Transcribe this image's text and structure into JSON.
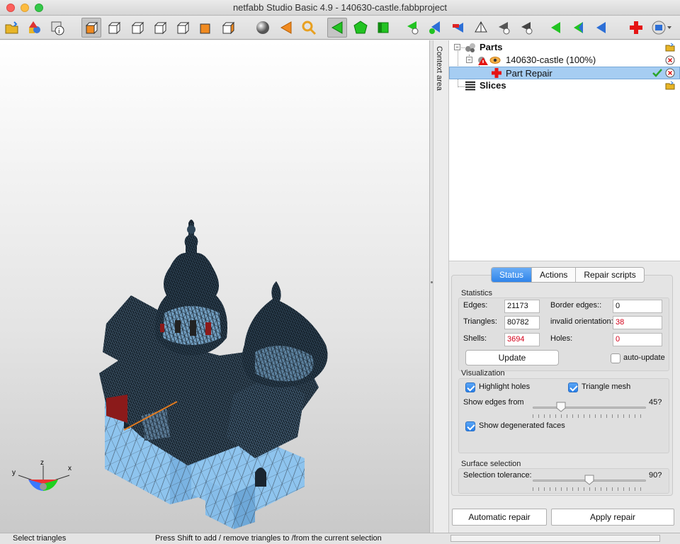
{
  "window": {
    "title": "netfabb Studio Basic 4.9 - 140630-castle.fabbproject"
  },
  "sidebar": {
    "context_label": "Context area"
  },
  "tree": {
    "parts_label": "Parts",
    "part_label": "140630-castle (100%)",
    "repair_label": "Part Repair",
    "slices_label": "Slices"
  },
  "panel": {
    "tabs": [
      {
        "label": "Status",
        "active": true
      },
      {
        "label": "Actions",
        "active": false
      },
      {
        "label": "Repair scripts",
        "active": false
      }
    ],
    "statistics": {
      "title": "Statistics",
      "edges_label": "Edges:",
      "edges_value": "21173",
      "border_edges_label": "Border edges::",
      "border_edges_value": "0",
      "triangles_label": "Triangles:",
      "triangles_value": "80782",
      "invalid_orientation_label": "invalid orientation:",
      "invalid_orientation_value": "38",
      "shells_label": "Shells:",
      "shells_value": "3694",
      "holes_label": "Holes:",
      "holes_value": "0",
      "update_label": "Update",
      "auto_update_label": "auto-update",
      "auto_update_checked": false
    },
    "visualization": {
      "title": "Visualization",
      "highlight_holes_label": "Highlight holes",
      "highlight_holes_checked": true,
      "triangle_mesh_label": "Triangle mesh",
      "triangle_mesh_checked": true,
      "show_edges_label": "Show edges from",
      "show_edges_value": "45?",
      "show_edges_slider_fraction": 0.25,
      "degenerated_label": "Show degenerated faces",
      "degenerated_checked": true
    },
    "surface": {
      "title": "Surface selection",
      "tolerance_label": "Selection tolerance:",
      "tolerance_value": "90?",
      "tolerance_slider_fraction": 0.5
    },
    "automatic_repair_label": "Automatic repair",
    "apply_repair_label": "Apply repair"
  },
  "axis": {
    "x": "x",
    "y": "y",
    "z": "z"
  },
  "statusbar": {
    "mode": "Select triangles",
    "hint": "Press Shift to add / remove triangles to /from the current selection"
  },
  "colors": {
    "mesh": "#8ec4ee",
    "wire": "#16202a",
    "accent": "#2f84ea",
    "warning": "#d4001a"
  }
}
